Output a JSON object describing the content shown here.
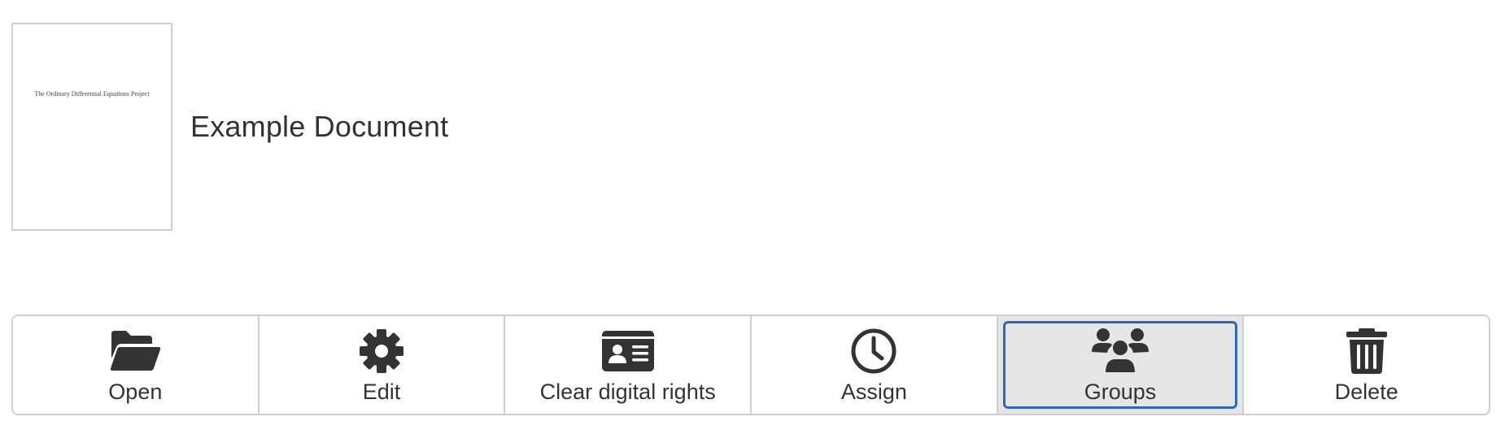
{
  "document": {
    "title": "Example Document",
    "thumbnail_text": "The Ordinary Differential Equations Project"
  },
  "toolbar": {
    "buttons": [
      {
        "label": "Open",
        "icon": "folder-open-icon"
      },
      {
        "label": "Edit",
        "icon": "gear-icon"
      },
      {
        "label": "Clear digital rights",
        "icon": "id-card-icon"
      },
      {
        "label": "Assign",
        "icon": "clock-icon"
      },
      {
        "label": "Groups",
        "icon": "users-icon",
        "active": true
      },
      {
        "label": "Delete",
        "icon": "trash-icon"
      }
    ]
  },
  "colors": {
    "text": "#333333",
    "border": "#cfcfcf",
    "active_bg": "#e6e6e6",
    "focus": "#2f66c4"
  }
}
